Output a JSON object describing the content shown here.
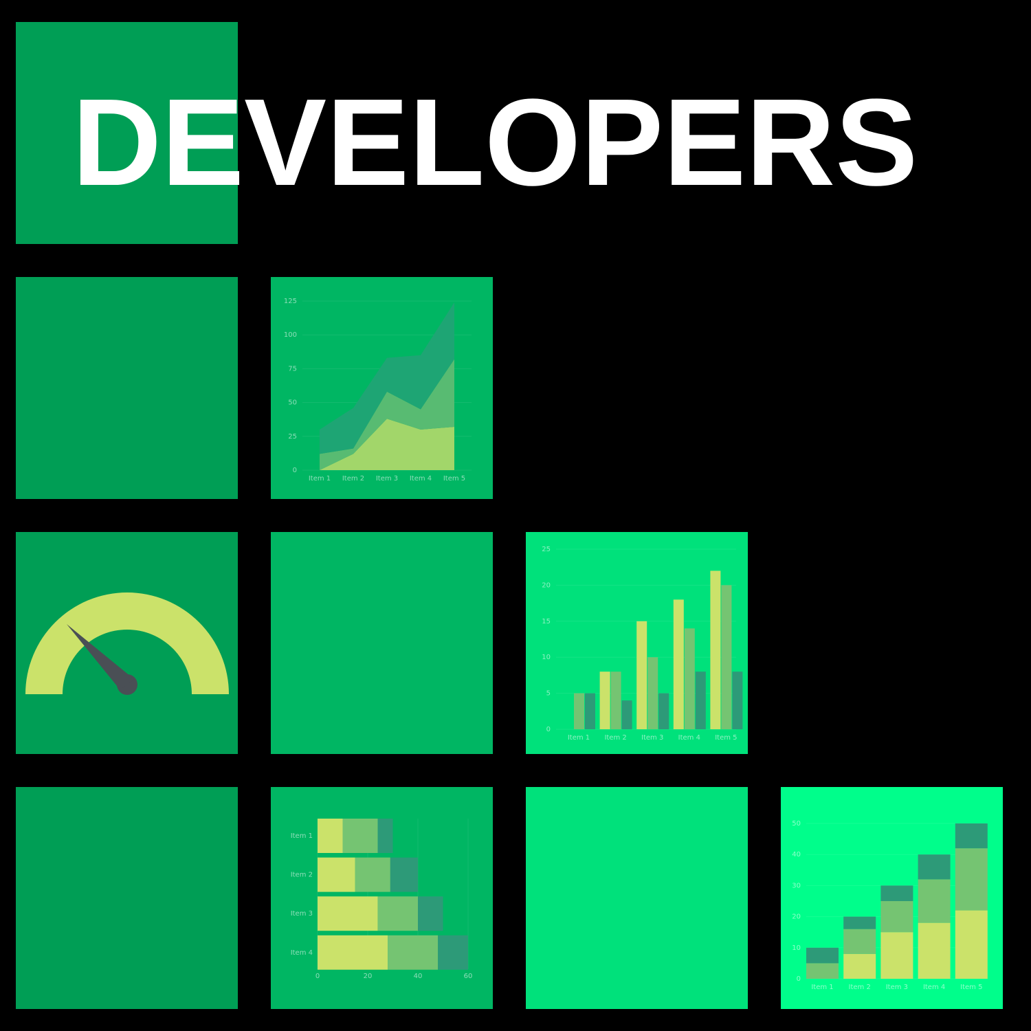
{
  "title": "DEVELOPERS",
  "colors": {
    "background": "#000000",
    "tile_dark": "#009e55",
    "tile_mid": "#00b663",
    "tile_light": "#00e17b",
    "tile_bright": "#00fe8b",
    "series": [
      "#cbe26a",
      "#75c472",
      "#2d9a78"
    ],
    "area_series": [
      "#a2d66a",
      "#58bb72",
      "#1ea574"
    ],
    "gauge_arc": "#cbe26a",
    "gauge_needle": "#4a4f55"
  },
  "gauge": {
    "level_percent": 25
  },
  "chart_data": [
    {
      "type": "area",
      "stacked": true,
      "categories": [
        "Item 1",
        "Item 2",
        "Item 3",
        "Item 4",
        "Item 5"
      ],
      "series": [
        {
          "values": [
            0,
            12,
            38,
            30,
            32
          ]
        },
        {
          "values": [
            12,
            4,
            20,
            15,
            50
          ]
        },
        {
          "values": [
            18,
            30,
            25,
            40,
            42
          ]
        }
      ],
      "ylim": [
        0,
        125
      ],
      "yticks": [
        "0",
        "25",
        "50",
        "75",
        "100",
        "125"
      ],
      "grid": true
    },
    {
      "type": "bar",
      "grouped": true,
      "categories": [
        "Item 1",
        "Item 2",
        "Item 3",
        "Item 4",
        "Item 5"
      ],
      "series": [
        {
          "values": [
            0,
            8,
            15,
            18,
            22
          ]
        },
        {
          "values": [
            5,
            8,
            10,
            14,
            20
          ]
        },
        {
          "values": [
            5,
            4,
            5,
            8,
            8
          ]
        }
      ],
      "ylim": [
        0,
        25
      ],
      "yticks": [
        "0",
        "5",
        "10",
        "15",
        "20",
        "25"
      ],
      "grid": true
    },
    {
      "type": "bar",
      "orientation": "horizontal",
      "stacked": true,
      "categories": [
        "Item 1",
        "Item 2",
        "Item 3",
        "Item 4"
      ],
      "series": [
        {
          "values": [
            10,
            15,
            24,
            28
          ]
        },
        {
          "values": [
            14,
            14,
            16,
            20
          ]
        },
        {
          "values": [
            6,
            11,
            10,
            12
          ]
        }
      ],
      "xlim": [
        0,
        60
      ],
      "xticks": [
        "0",
        "20",
        "40",
        "60"
      ],
      "grid": true
    },
    {
      "type": "bar",
      "stacked": true,
      "categories": [
        "Item 1",
        "Item 2",
        "Item 3",
        "Item 4",
        "Item 5"
      ],
      "series": [
        {
          "values": [
            0,
            8,
            15,
            18,
            22
          ]
        },
        {
          "values": [
            5,
            8,
            10,
            14,
            20
          ]
        },
        {
          "values": [
            5,
            4,
            5,
            8,
            8
          ]
        }
      ],
      "ylim": [
        0,
        50
      ],
      "yticks": [
        "0",
        "10",
        "20",
        "30",
        "40",
        "50"
      ],
      "grid": true
    }
  ]
}
